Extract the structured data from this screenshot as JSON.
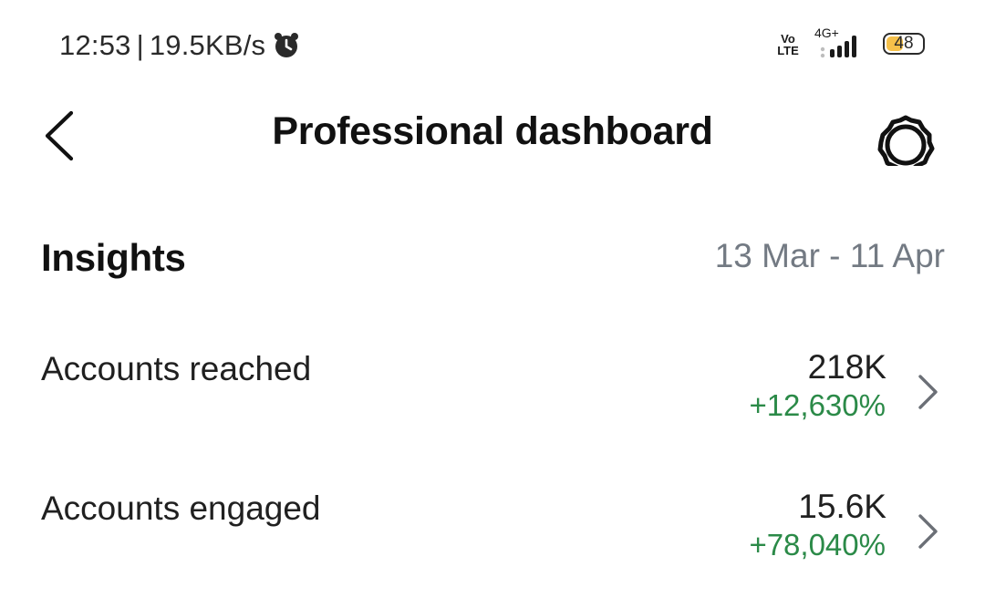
{
  "status_bar": {
    "time": "12:53",
    "separator": "|",
    "network_speed": "19.5KB/s",
    "volte_top": "Vo",
    "volte_bottom": "LTE",
    "network_type": "4G+",
    "battery_level": "48",
    "battery_fraction": 0.48,
    "battery_fill_color": "#f5c04a",
    "icons": [
      "alarm-icon",
      "volte-icon",
      "signal-icon",
      "battery-icon"
    ]
  },
  "header": {
    "title": "Professional dashboard",
    "back_icon": "chevron-left-icon",
    "settings_icon": "gear-icon"
  },
  "insights": {
    "title": "Insights",
    "date_range": "13 Mar - 11 Apr",
    "metrics": [
      {
        "label": "Accounts reached",
        "value": "218K",
        "change": "+12,630%"
      },
      {
        "label": "Accounts engaged",
        "value": "15.6K",
        "change": "+78,040%"
      }
    ]
  },
  "colors": {
    "positive_change": "#2b8a48",
    "secondary_text": "#737a83",
    "primary_text": "#111111"
  }
}
